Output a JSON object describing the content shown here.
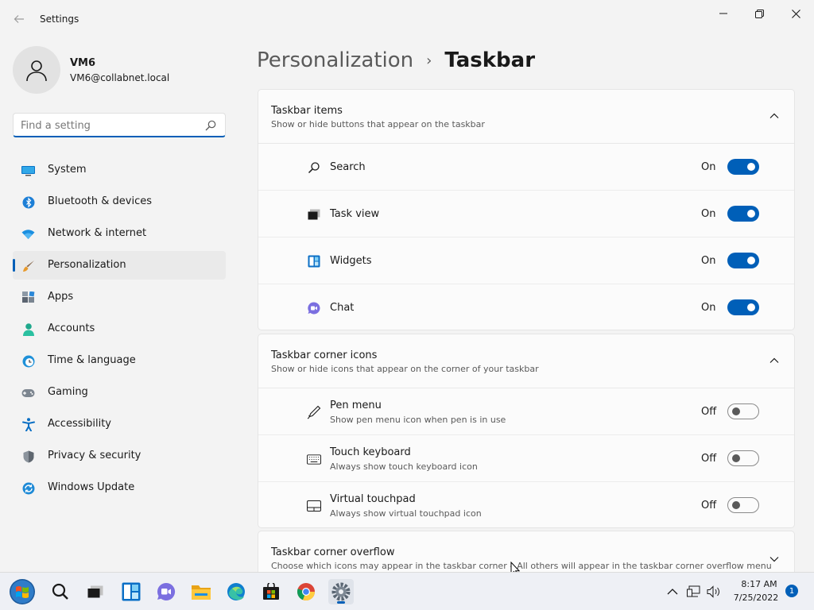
{
  "window": {
    "title": "Settings"
  },
  "account": {
    "name": "VM6",
    "email": "VM6@collabnet.local"
  },
  "search": {
    "placeholder": "Find a setting",
    "value": ""
  },
  "nav": [
    {
      "label": "System",
      "icon": "monitor-icon"
    },
    {
      "label": "Bluetooth & devices",
      "icon": "bluetooth-icon"
    },
    {
      "label": "Network & internet",
      "icon": "wifi-icon"
    },
    {
      "label": "Personalization",
      "icon": "brush-icon",
      "active": true
    },
    {
      "label": "Apps",
      "icon": "apps-icon"
    },
    {
      "label": "Accounts",
      "icon": "person-icon"
    },
    {
      "label": "Time & language",
      "icon": "globe-clock-icon"
    },
    {
      "label": "Gaming",
      "icon": "gamepad-icon"
    },
    {
      "label": "Accessibility",
      "icon": "accessibility-icon"
    },
    {
      "label": "Privacy & security",
      "icon": "shield-icon"
    },
    {
      "label": "Windows Update",
      "icon": "sync-icon"
    }
  ],
  "breadcrumb": {
    "parent": "Personalization",
    "separator": "›",
    "current": "Taskbar"
  },
  "sections": [
    {
      "title": "Taskbar items",
      "description": "Show or hide buttons that appear on the taskbar",
      "expanded": true,
      "items": [
        {
          "label": "Search",
          "state": "On",
          "icon": "search-icon"
        },
        {
          "label": "Task view",
          "state": "On",
          "icon": "task-view-icon"
        },
        {
          "label": "Widgets",
          "state": "On",
          "icon": "widgets-icon"
        },
        {
          "label": "Chat",
          "state": "On",
          "icon": "chat-icon"
        }
      ]
    },
    {
      "title": "Taskbar corner icons",
      "description": "Show or hide icons that appear on the corner of your taskbar",
      "expanded": true,
      "items": [
        {
          "label": "Pen menu",
          "sub": "Show pen menu icon when pen is in use",
          "state": "Off",
          "icon": "pen-icon"
        },
        {
          "label": "Touch keyboard",
          "sub": "Always show touch keyboard icon",
          "state": "Off",
          "icon": "keyboard-icon"
        },
        {
          "label": "Virtual touchpad",
          "sub": "Always show virtual touchpad icon",
          "state": "Off",
          "icon": "touchpad-icon"
        }
      ]
    },
    {
      "title": "Taskbar corner overflow",
      "description": "Choose which icons may appear in the taskbar corner – All others will appear in the taskbar corner overflow menu",
      "expanded": false
    }
  ],
  "taskbar": {
    "apps": [
      "start-icon",
      "search-icon",
      "task-view-icon",
      "widgets-icon",
      "chat-icon",
      "file-explorer-icon",
      "edge-icon",
      "store-icon",
      "chrome-icon",
      "settings-icon"
    ],
    "active": "settings-icon",
    "clock": {
      "time": "8:17 AM",
      "date": "7/25/2022"
    },
    "notification_count": "1"
  },
  "colors": {
    "accent": "#005fb8",
    "background": "#f3f3f3",
    "card": "#fbfbfb"
  }
}
